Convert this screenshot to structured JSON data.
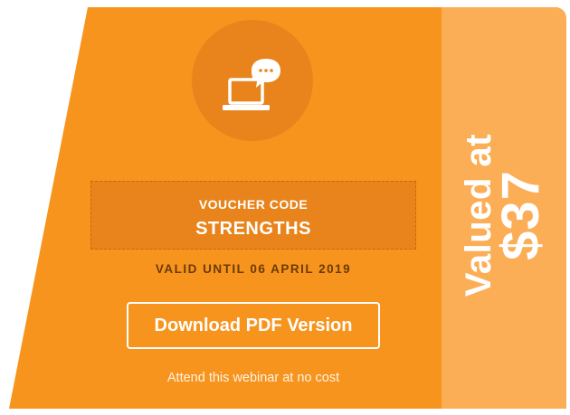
{
  "voucher": {
    "label": "VOUCHER CODE",
    "code": "STRENGTHS",
    "validity": "VALID UNTIL 06 APRIL 2019"
  },
  "stub": {
    "label": "Valued at",
    "value": "$37"
  },
  "download_button": "Download PDF Version",
  "note": "Attend this webinar at no cost",
  "icon": "webinar-laptop-chat-icon",
  "colors": {
    "card": "#f7941e",
    "stub": "#fbae55",
    "circle": "#e8841b",
    "validity_text": "#6b3a06"
  }
}
